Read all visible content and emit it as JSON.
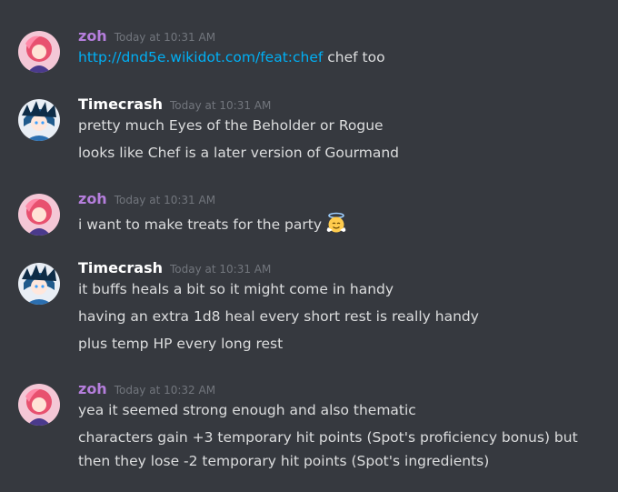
{
  "colors": {
    "background": "#36393f",
    "zoh_name": "#b57edc",
    "timecrash_name": "#ffffff",
    "timestamp": "#72767d",
    "text": "#dcddde",
    "link": "#00aff4"
  },
  "messages": [
    {
      "author": "zoh",
      "timestamp": "Today at 10:31 AM",
      "lines": [
        {
          "link": "http://dnd5e.wikidot.com/feat:chef",
          "text": " chef too"
        }
      ]
    },
    {
      "author": "Timecrash",
      "timestamp": "Today at 10:31 AM",
      "lines": [
        {
          "text": "pretty much Eyes of the Beholder or Rogue"
        },
        {
          "text": "looks like Chef is a later version of Gourmand"
        }
      ]
    },
    {
      "author": "zoh",
      "timestamp": "Today at 10:31 AM",
      "lines": [
        {
          "text": "i want to make treats for the party",
          "emoji": "angel-face-emoji"
        }
      ]
    },
    {
      "author": "Timecrash",
      "timestamp": "Today at 10:31 AM",
      "lines": [
        {
          "text": "it buffs heals a bit so it might come in handy"
        },
        {
          "text": "having an extra 1d8 heal every short rest is really handy"
        },
        {
          "text": "plus temp HP every long rest"
        }
      ]
    },
    {
      "author": "zoh",
      "timestamp": "Today at 10:32 AM",
      "lines": [
        {
          "text": "yea it seemed strong enough and also thematic"
        },
        {
          "text": "characters gain +3 temporary hit points (Spot's proficiency bonus) but"
        },
        {
          "text": "then they lose -2 temporary hit points (Spot's ingredients)"
        }
      ]
    }
  ]
}
